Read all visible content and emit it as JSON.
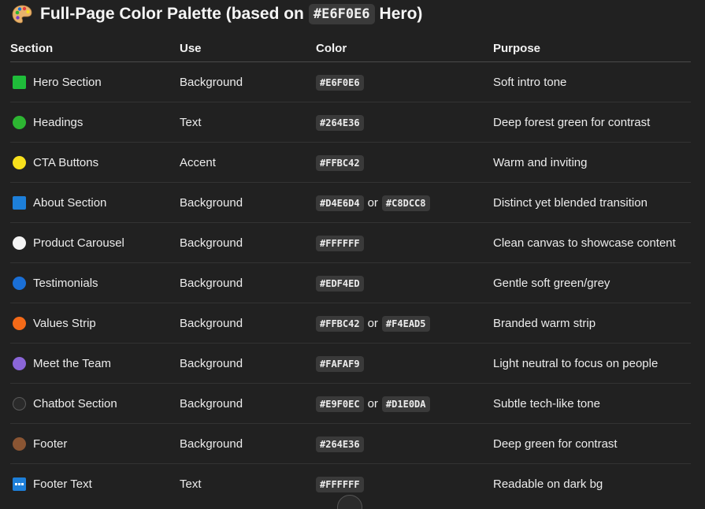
{
  "title": {
    "emoji_icon": "artist-palette-icon",
    "prefix": "Full-Page Color Palette (based on",
    "code": "#E6F0E6",
    "suffix": "Hero)"
  },
  "table": {
    "headers": [
      "Section",
      "Use",
      "Color",
      "Purpose"
    ],
    "rows": [
      {
        "section": "Hero Section",
        "icon": "green-square-icon",
        "swatch": "#1fbd3a",
        "shape": "square",
        "use": "Background",
        "color1": "#E6F0E6",
        "or": "",
        "color2": "",
        "purpose": "Soft intro tone"
      },
      {
        "section": "Headings",
        "icon": "green-circle-icon",
        "swatch": "#2db532",
        "shape": "circle",
        "use": "Text",
        "color1": "#264E36",
        "or": "",
        "color2": "",
        "purpose": "Deep forest green for contrast"
      },
      {
        "section": "CTA Buttons",
        "icon": "yellow-circle-icon",
        "swatch": "#f7e01c",
        "shape": "circle",
        "use": "Accent",
        "color1": "#FFBC42",
        "or": "",
        "color2": "",
        "purpose": "Warm and inviting"
      },
      {
        "section": "About Section",
        "icon": "blue-square-icon",
        "swatch": "#1d7fd9",
        "shape": "square",
        "use": "Background",
        "color1": "#D4E6D4",
        "or": "or",
        "color2": "#C8DCC8",
        "purpose": "Distinct yet blended transition"
      },
      {
        "section": "Product Carousel",
        "icon": "white-circle-icon",
        "swatch": "#f4f4f4",
        "shape": "circle",
        "use": "Background",
        "color1": "#FFFFFF",
        "or": "",
        "color2": "",
        "purpose": "Clean canvas to showcase content"
      },
      {
        "section": "Testimonials",
        "icon": "blue-circle-icon",
        "swatch": "#1a6fd6",
        "shape": "circle",
        "use": "Background",
        "color1": "#EDF4ED",
        "or": "",
        "color2": "",
        "purpose": "Gentle soft green/grey"
      },
      {
        "section": "Values Strip",
        "icon": "orange-circle-icon",
        "swatch": "#f46a18",
        "shape": "circle",
        "use": "Background",
        "color1": "#FFBC42",
        "or": "or",
        "color2": "#F4EAD5",
        "purpose": "Branded warm strip"
      },
      {
        "section": "Meet the Team",
        "icon": "purple-circle-icon",
        "swatch": "#8b66d8",
        "shape": "circle",
        "use": "Background",
        "color1": "#FAFAF9",
        "or": "",
        "color2": "",
        "purpose": "Light neutral to focus on people"
      },
      {
        "section": "Chatbot Section",
        "icon": "black-circle-icon",
        "swatch": "#2a2a2a",
        "shape": "circle-outlined",
        "use": "Background",
        "color1": "#E9F0EC",
        "or": "or",
        "color2": "#D1E0DA",
        "purpose": "Subtle tech-like tone"
      },
      {
        "section": "Footer",
        "icon": "brown-circle-icon",
        "swatch": "#8a5533",
        "shape": "circle",
        "use": "Background",
        "color1": "#264E36",
        "or": "",
        "color2": "",
        "purpose": "Deep green for contrast"
      },
      {
        "section": "Footer Text",
        "icon": "abc-input-icon",
        "swatch": "#1d7fd9",
        "shape": "abc",
        "use": "Text",
        "color1": "#FFFFFF",
        "or": "",
        "color2": "",
        "purpose": "Readable on dark bg"
      }
    ]
  },
  "scroll_button": {
    "icon": "scroll-down-icon"
  }
}
